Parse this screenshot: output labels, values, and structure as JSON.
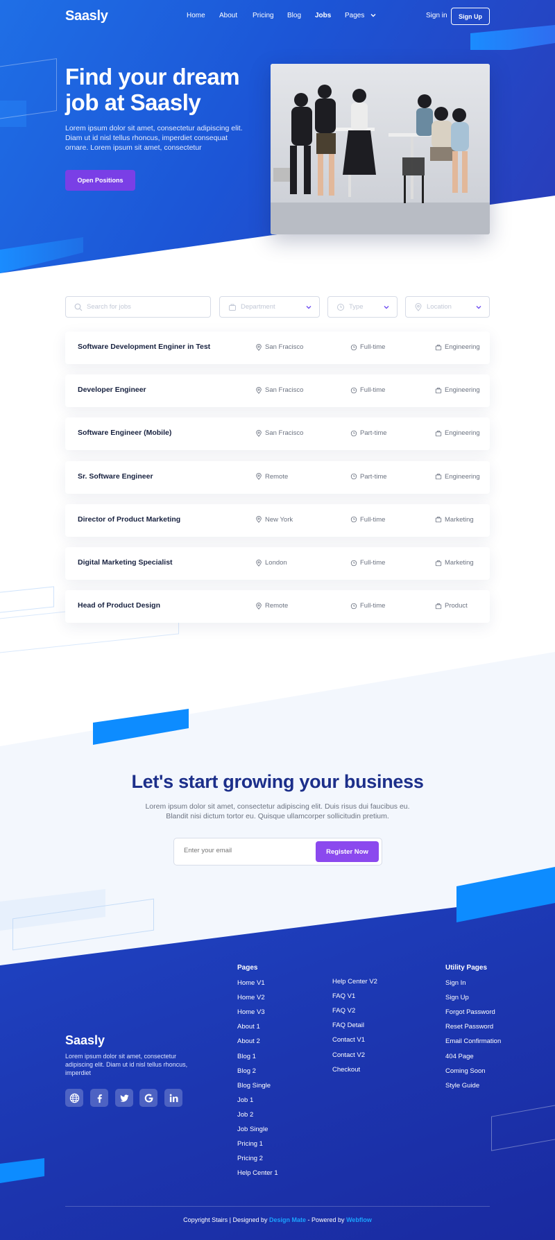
{
  "brand": {
    "name": "Saasly"
  },
  "nav": {
    "links": [
      "Home",
      "About",
      "Pricing",
      "Blog",
      "Jobs",
      "Pages"
    ],
    "active": "Jobs",
    "signin": "Sign in",
    "signup": "Sign Up"
  },
  "hero": {
    "title": "Find your dream job at Saasly",
    "text": "Lorem ipsum dolor sit amet, consectetur adipiscing elit. Diam ut id nisl tellus rhoncus, imperdiet consequat ornare. Lorem ipsum sit amet, consectetur",
    "button": "Open Positions"
  },
  "filters": {
    "search_placeholder": "Search for jobs",
    "department": "Department",
    "type": "Type",
    "location": "Location"
  },
  "jobs": [
    {
      "title": "Software Development Enginer in Test",
      "location": "San Fracisco",
      "type": "Full-time",
      "department": "Engineering"
    },
    {
      "title": "Developer Engineer",
      "location": "San Fracisco",
      "type": "Full-time",
      "department": "Engineering"
    },
    {
      "title": "Software Engineer (Mobile)",
      "location": "San Fracisco",
      "type": "Part-time",
      "department": "Engineering"
    },
    {
      "title": "Sr. Software Engineer",
      "location": "Remote",
      "type": "Part-time",
      "department": "Engineering"
    },
    {
      "title": "Director of Product Marketing",
      "location": "New York",
      "type": "Full-time",
      "department": "Marketing"
    },
    {
      "title": "Digital Marketing Specialist",
      "location": "London",
      "type": "Full-time",
      "department": "Marketing"
    },
    {
      "title": "Head of Product Design",
      "location": "Remote",
      "type": "Full-time",
      "department": "Product"
    }
  ],
  "cta": {
    "title": "Let's start growing your business",
    "text": "Lorem ipsum dolor sit amet, consectetur adipiscing elit. Duis risus dui faucibus eu. Blandit nisi dictum tortor eu. Quisque ullamcorper sollicitudin pretium.",
    "email_placeholder": "Enter your email",
    "button": "Register Now"
  },
  "footer": {
    "logo": "Saasly",
    "text": "Lorem ipsum dolor sit amet, consectetur adipiscing elit. Diam ut id nisl tellus rhoncus, imperdiet",
    "social_icons": [
      "globe-icon",
      "facebook-icon",
      "twitter-icon",
      "google-icon",
      "linkedin-icon"
    ],
    "pages_heading": "Pages",
    "pages_col1": [
      "Home V1",
      "Home V2",
      "Home V3",
      "About 1",
      "About 2",
      "Blog 1",
      "Blog 2",
      "Blog Single",
      "Job 1",
      "Job 2",
      "Job Single",
      "Pricing 1",
      "Pricing 2",
      "Help Center 1"
    ],
    "pages_col2": [
      "Help Center V2",
      "FAQ V1",
      "FAQ V2",
      "FAQ Detail",
      "Contact V1",
      "Contact V2",
      "Checkout"
    ],
    "utility_heading": "Utility Pages",
    "utility_links": [
      "Sign In",
      "Sign Up",
      "Forgot Password",
      "Reset Password",
      "Email Confirmation",
      "404 Page",
      "Coming Soon",
      "Style Guide"
    ],
    "copyright_prefix": "Copyright Stairs | Designed by",
    "designer": "Design Mate",
    "powered_prefix": "- Powered by",
    "powered": "Webflow"
  },
  "colors": {
    "hero_blue": "#1f6fe6",
    "accent_purple": "#7a3fe6",
    "cta_title": "#1c2f8a",
    "footer_blue": "#1c36b0",
    "link_accent": "#1aa3ff"
  }
}
